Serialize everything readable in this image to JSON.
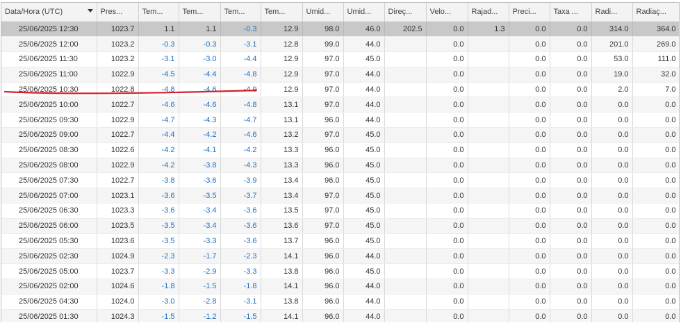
{
  "header": {
    "columns": [
      "Data/Hora (UTC)",
      "Pres...",
      "Tem...",
      "Tem...",
      "Tem...",
      "Tem...",
      "Umid...",
      "Umid...",
      "Direç...",
      "Velo...",
      "Rajad...",
      "Preci...",
      "Taxa ...",
      "Radi...",
      "Radiaç..."
    ]
  },
  "rows": [
    [
      "25/06/2025 12:30",
      "1023.7",
      "1.1",
      "1.1",
      "-0.3",
      "12.9",
      "98.0",
      "46.0",
      "202.5",
      "0.0",
      "1.3",
      "0.0",
      "0.0",
      "314.0",
      "364.0"
    ],
    [
      "25/06/2025 12:00",
      "1023.2",
      "-0.3",
      "-0.3",
      "-3.1",
      "12.8",
      "99.0",
      "44.0",
      "",
      "0.0",
      "",
      "0.0",
      "0.0",
      "201.0",
      "269.0"
    ],
    [
      "25/06/2025 11:30",
      "1023.2",
      "-3.1",
      "-3.0",
      "-4.4",
      "12.9",
      "97.0",
      "45.0",
      "",
      "0.0",
      "",
      "0.0",
      "0.0",
      "53.0",
      "111.0"
    ],
    [
      "25/06/2025 11:00",
      "1022.9",
      "-4.5",
      "-4.4",
      "-4.8",
      "12.9",
      "97.0",
      "44.0",
      "",
      "0.0",
      "",
      "0.0",
      "0.0",
      "19.0",
      "32.0"
    ],
    [
      "25/06/2025 10:30",
      "1022.8",
      "-4.8",
      "-4.6",
      "-4.9",
      "12.9",
      "97.0",
      "44.0",
      "",
      "0.0",
      "",
      "0.0",
      "0.0",
      "2.0",
      "7.0"
    ],
    [
      "25/06/2025 10:00",
      "1022.7",
      "-4.6",
      "-4.6",
      "-4.8",
      "13.1",
      "97.0",
      "44.0",
      "",
      "0.0",
      "",
      "0.0",
      "0.0",
      "0.0",
      "0.0"
    ],
    [
      "25/06/2025 09:30",
      "1022.9",
      "-4.7",
      "-4.3",
      "-4.7",
      "13.1",
      "96.0",
      "44.0",
      "",
      "0.0",
      "",
      "0.0",
      "0.0",
      "0.0",
      "0.0"
    ],
    [
      "25/06/2025 09:00",
      "1022.7",
      "-4.4",
      "-4.2",
      "-4.6",
      "13.2",
      "97.0",
      "45.0",
      "",
      "0.0",
      "",
      "0.0",
      "0.0",
      "0.0",
      "0.0"
    ],
    [
      "25/06/2025 08:30",
      "1022.6",
      "-4.2",
      "-4.1",
      "-4.2",
      "13.3",
      "96.0",
      "45.0",
      "",
      "0.0",
      "",
      "0.0",
      "0.0",
      "0.0",
      "0.0"
    ],
    [
      "25/06/2025 08:00",
      "1022.9",
      "-4.2",
      "-3.8",
      "-4.3",
      "13.3",
      "96.0",
      "45.0",
      "",
      "0.0",
      "",
      "0.0",
      "0.0",
      "0.0",
      "0.0"
    ],
    [
      "25/06/2025 07:30",
      "1022.7",
      "-3.8",
      "-3.6",
      "-3.9",
      "13.4",
      "96.0",
      "45.0",
      "",
      "0.0",
      "",
      "0.0",
      "0.0",
      "0.0",
      "0.0"
    ],
    [
      "25/06/2025 07:00",
      "1023.1",
      "-3.6",
      "-3.5",
      "-3.7",
      "13.4",
      "97.0",
      "45.0",
      "",
      "0.0",
      "",
      "0.0",
      "0.0",
      "0.0",
      "0.0"
    ],
    [
      "25/06/2025 06:30",
      "1023.3",
      "-3.6",
      "-3.4",
      "-3.6",
      "13.5",
      "97.0",
      "45.0",
      "",
      "0.0",
      "",
      "0.0",
      "0.0",
      "0.0",
      "0.0"
    ],
    [
      "25/06/2025 06:00",
      "1023.5",
      "-3.5",
      "-3.4",
      "-3.6",
      "13.6",
      "97.0",
      "45.0",
      "",
      "0.0",
      "",
      "0.0",
      "0.0",
      "0.0",
      "0.0"
    ],
    [
      "25/06/2025 05:30",
      "1023.6",
      "-3.5",
      "-3.3",
      "-3.6",
      "13.7",
      "96.0",
      "45.0",
      "",
      "0.0",
      "",
      "0.0",
      "0.0",
      "0.0",
      "0.0"
    ],
    [
      "25/06/2025 02:30",
      "1024.9",
      "-2.3",
      "-1.7",
      "-2.3",
      "14.1",
      "96.0",
      "44.0",
      "",
      "0.0",
      "",
      "0.0",
      "0.0",
      "0.0",
      "0.0"
    ],
    [
      "25/06/2025 05:00",
      "1023.7",
      "-3.3",
      "-2.9",
      "-3.3",
      "13.8",
      "96.0",
      "45.0",
      "",
      "0.0",
      "",
      "0.0",
      "0.0",
      "0.0",
      "0.0"
    ],
    [
      "25/06/2025 02:00",
      "1024.6",
      "-1.8",
      "-1.5",
      "-1.8",
      "14.1",
      "96.0",
      "44.0",
      "",
      "0.0",
      "",
      "0.0",
      "0.0",
      "0.0",
      "0.0"
    ],
    [
      "25/06/2025 04:30",
      "1024.0",
      "-3.0",
      "-2.8",
      "-3.1",
      "13.8",
      "96.0",
      "44.0",
      "",
      "0.0",
      "",
      "0.0",
      "0.0",
      "0.0",
      "0.0"
    ],
    [
      "25/06/2025 01:30",
      "1024.3",
      "-1.5",
      "-1.2",
      "-1.5",
      "14.1",
      "96.0",
      "44.0",
      "",
      "0.0",
      "",
      "0.0",
      "0.0",
      "0.0",
      "0.0"
    ]
  ],
  "selected_row": 0,
  "colors": {
    "negative_temp": "#1f6fc5",
    "selected_row": "#c8c8c8",
    "annotation_underline": "#d3202a"
  }
}
